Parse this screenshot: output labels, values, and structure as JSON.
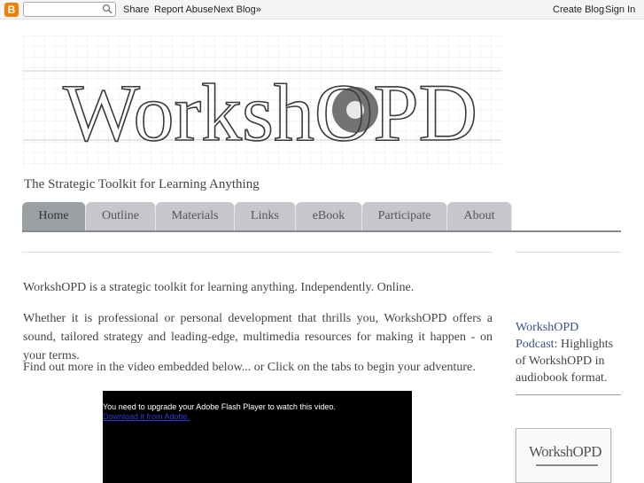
{
  "navbar": {
    "logo": "B",
    "share": "Share",
    "report_abuse": "Report Abuse",
    "next_blog": "Next Blog»",
    "create_blog": "Create Blog",
    "sign_in": "Sign In"
  },
  "header": {
    "logo_text": "WorkshOPD",
    "tagline": "The Strategic Toolkit for Learning Anything"
  },
  "tabs": [
    {
      "label": "Home",
      "active": true
    },
    {
      "label": "Outline"
    },
    {
      "label": "Materials"
    },
    {
      "label": "Links"
    },
    {
      "label": "eBook"
    },
    {
      "label": "Participate"
    },
    {
      "label": "About"
    }
  ],
  "main": {
    "p1": "WorkshOPD is a strategic toolkit for learning anything. Independently. Online.",
    "p2": "Whether it is professional or personal development that thrills you, WorkshOPD offers a sound, tailored strategy and leading-edge, multimedia resources for making it happen - on your terms.",
    "p3": "Find out more in the video embedded below... or Click on the tabs to begin your adventure.",
    "video_message": "You need to upgrade your Adobe Flash Player to watch this video.",
    "video_link": "Download it from Adobe."
  },
  "sidebar": {
    "podcast_title": "WorkshOPD Podcast",
    "podcast_desc": ": Highlights of WorkshOPD in audiobook format.",
    "thumb_text": "WorkshOPD"
  },
  "colors": {
    "tab_bg": "#c6c6cc",
    "tab_active_bg": "#9aa0a4",
    "link": "#3a4e8a",
    "blogger_orange": "#f57d00"
  }
}
